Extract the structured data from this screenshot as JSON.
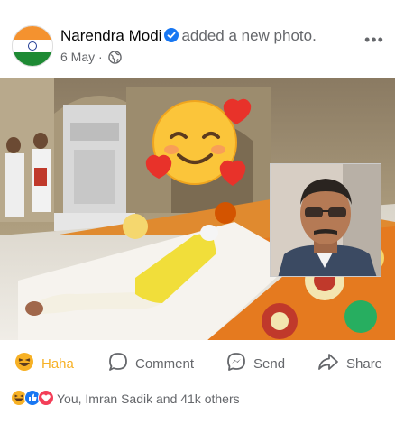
{
  "post": {
    "author": "Narendra Modi",
    "action": "added a new photo.",
    "date": "6 May",
    "separator": "·",
    "more": "•••",
    "privacy_icon": "globe-icon"
  },
  "photo": {
    "description_icon": "temple-prostration-photo",
    "overlay_emoji": "smiling-face-with-hearts",
    "inset_photo": "man-with-sunglasses"
  },
  "actions": {
    "haha": "Haha",
    "comment": "Comment",
    "send": "Send",
    "share": "Share"
  },
  "reactions": {
    "summary": "You, Imran Sadik and 41k others",
    "icons": [
      "haha-icon",
      "like-icon",
      "love-icon"
    ]
  },
  "colors": {
    "accent": "#1877f2",
    "haha": "#f7b125",
    "secondary_text": "#65676b"
  }
}
